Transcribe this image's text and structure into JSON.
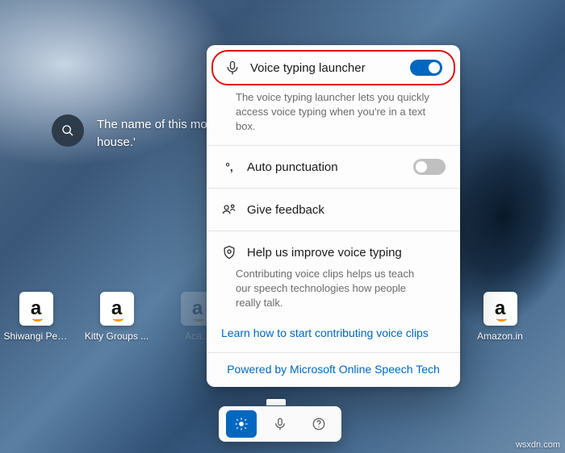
{
  "search": {
    "text": "The name of this mo\nhouse.'"
  },
  "desktop_icons": [
    {
      "label": "Shiwangi Pes..."
    },
    {
      "label": "Kitty Groups ..."
    },
    {
      "label": "Aca..."
    },
    {
      "label": "..."
    },
    {
      "label": "..."
    },
    {
      "label": "Amazon.in"
    }
  ],
  "panel": {
    "voice_launcher": {
      "label": "Voice typing launcher",
      "desc": "The voice typing launcher lets you quickly access voice typing when you're in a text box.",
      "on": true
    },
    "auto_punct": {
      "label": "Auto punctuation",
      "on": false
    },
    "feedback": {
      "label": "Give feedback"
    },
    "improve": {
      "label": "Help us improve voice typing",
      "desc": "Contributing voice clips helps us teach our speech technologies how people really talk."
    },
    "link": "Learn how to start contributing voice clips",
    "footer": "Powered by Microsoft Online Speech Tech"
  },
  "watermark": "wsxdn.com"
}
